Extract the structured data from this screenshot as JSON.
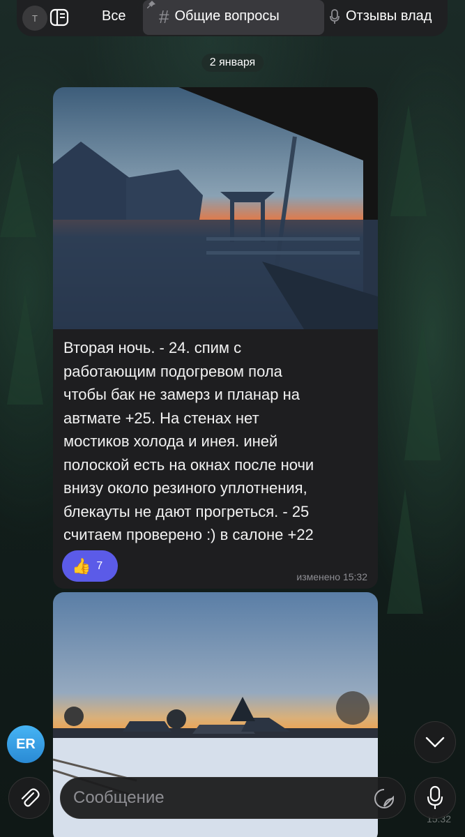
{
  "tabs": {
    "peek_avatar": "Т",
    "all_label": "Все",
    "questions_label": "Общие вопросы",
    "reviews_label": "Отзывы влад"
  },
  "chat": {
    "date": "2 января",
    "message1": {
      "text": "Вторая ночь.  - 24. спим с\nработающим подогревом пола\nчтобы бак не замерз и планар на\nавтмате +25. На стенах нет\nмостиков холода и инея. иней\nполоской есть на окнах после ночи\nвнизу около резиного уплотнения,\nблекауты не дают прогреться. - 25\nсчитаем проверено :) в салоне +22",
      "reaction_emoji": "👍",
      "reaction_count": "7",
      "status": "изменено 15:32"
    },
    "message2": {
      "time": "15:32"
    },
    "sender_avatar": "ER"
  },
  "composer": {
    "placeholder": "Сообщение"
  },
  "icons": {
    "tab_folder": "sidebar-icon",
    "pin": "pin-icon",
    "hash": "hash-icon",
    "mic_tab": "microphone-icon",
    "attach": "paperclip-icon",
    "sticker": "sticker-icon",
    "mic": "microphone-icon",
    "scroll": "chevron-down-icon"
  },
  "colors": {
    "accent_reaction": "#5b5be8",
    "avatar": "#3a9ee6",
    "bubble": "#1e1e20"
  }
}
